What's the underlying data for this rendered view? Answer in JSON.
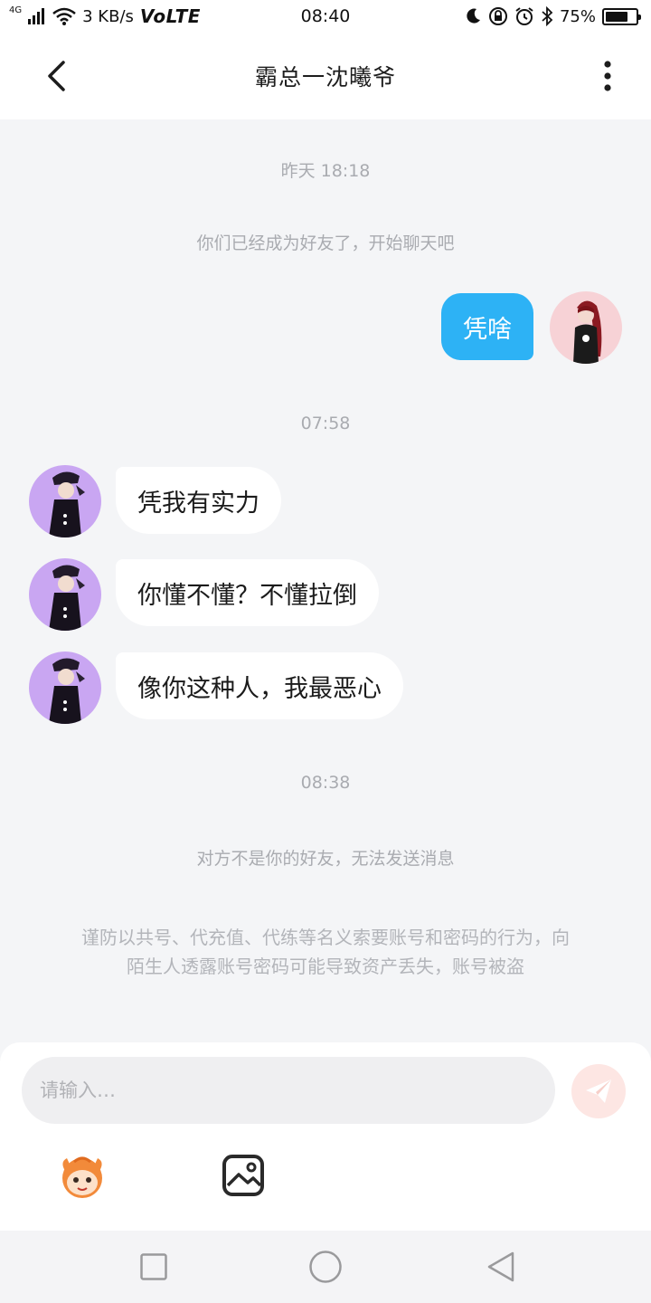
{
  "status_bar": {
    "network": "4G",
    "speed": "3 KB/s",
    "volte": "VoLTE",
    "time": "08:40",
    "battery_text": "75%",
    "battery_level": 0.75,
    "icons": [
      "signal-icon",
      "wifi-icon",
      "moon-icon",
      "rotation-lock-icon",
      "alarm-icon",
      "bluetooth-icon",
      "battery-icon"
    ]
  },
  "header": {
    "title": "霸总一沈曦爷",
    "back_icon": "chevron-left-icon",
    "more_icon": "more-vertical-icon"
  },
  "chat": {
    "timestamp_1": "昨天 18:18",
    "friend_notice": "你们已经成为好友了，开始聊天吧",
    "outgoing_message": "凭啥",
    "timestamp_2": "07:58",
    "incoming_messages": [
      "凭我有实力",
      "你懂不懂？不懂拉倒",
      "像你这种人，我最恶心"
    ],
    "timestamp_3": "08:38",
    "not_friend_notice": "对方不是你的好友，无法发送消息",
    "security_notice_line1": "谨防以共号、代充值、代练等名义索要账号和密码的行为，向",
    "security_notice_line2": "陌生人透露账号密码可能导致资产丢失，账号被盗"
  },
  "input": {
    "placeholder": "请输入…",
    "send_icon": "send-icon",
    "emoji_icon": "emoji-face-icon",
    "image_icon": "image-icon"
  },
  "nav": {
    "icons": [
      "recent-apps-icon",
      "home-icon",
      "back-icon"
    ]
  },
  "colors": {
    "accent_bubble": "#2db2f5",
    "background": "#f4f5f7",
    "send_button": "#fde6e3",
    "avatar_other": "#c9a6f2",
    "avatar_self": "#f7d2d6"
  }
}
